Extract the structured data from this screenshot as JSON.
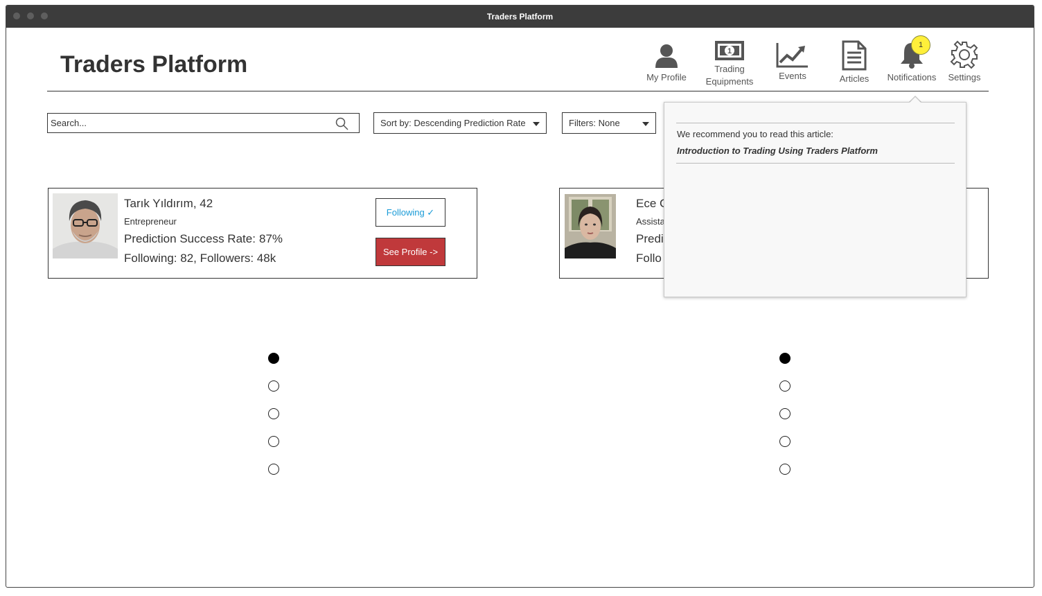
{
  "window": {
    "title": "Traders Platform"
  },
  "header": {
    "app_title": "Traders Platform",
    "nav": [
      {
        "label": "My Profile",
        "icon": "user-icon"
      },
      {
        "label": "Trading",
        "label2": "Equipments",
        "icon": "money-icon"
      },
      {
        "label": "Events",
        "icon": "chart-icon"
      },
      {
        "label": "Articles",
        "icon": "document-icon"
      },
      {
        "label": "Notifications",
        "icon": "bell-icon",
        "badge": "1"
      },
      {
        "label": "Settings",
        "icon": "gear-icon"
      }
    ]
  },
  "toolbar": {
    "search_placeholder": "Search...",
    "sort_label": "Sort by: Descending Prediction Rate",
    "filter_label": "Filters: None"
  },
  "cards": [
    {
      "name": "Tarık Yıldırım, 42",
      "role": "Entrepreneur",
      "rate_label": "Prediction Success Rate:",
      "rate_value": "87%",
      "follow_stats": "Following: 82, Followers: 48k",
      "following_button": "Following ✓",
      "profile_button": "See Profile ->"
    },
    {
      "name": "Ece G",
      "role": "Assista",
      "rate_label": "Predi",
      "follow_stats": "Follo"
    }
  ],
  "notification_popover": {
    "message": "We recommend you to read this article:",
    "article_title": "Introduction to Trading Using Traders Platform"
  },
  "pagers": {
    "dot_count": 5,
    "active_index": 0
  },
  "colors": {
    "titlebar": "#3c3c3c",
    "badge": "#ffef3a",
    "following_text": "#1a9bd7",
    "profile_button": "#c0393b"
  }
}
